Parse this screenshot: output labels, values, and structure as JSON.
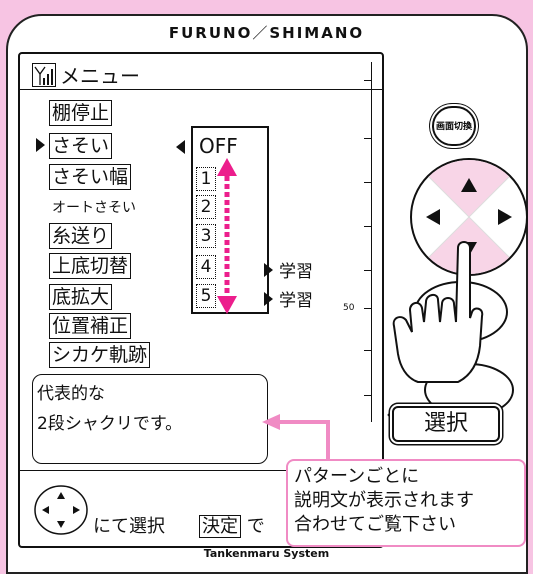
{
  "brand": {
    "left": "FURUNO",
    "separator": "／",
    "right": "SHIMANO"
  },
  "menu": {
    "title": "メニュー",
    "items": [
      {
        "label": "棚停止"
      },
      {
        "label": "さそい"
      },
      {
        "label": "さそい幅"
      },
      {
        "label": "オートさそい"
      },
      {
        "label": "糸送り"
      },
      {
        "label": "上底切替"
      },
      {
        "label": "底拡大"
      },
      {
        "label": "位置補正"
      },
      {
        "label": "シカケ軌跡"
      }
    ]
  },
  "popup": {
    "off_label": "OFF",
    "options": [
      "1",
      "2",
      "3",
      "4",
      "5"
    ],
    "learn_label_4": "学習",
    "learn_label_5": "学習"
  },
  "scale": {
    "label": "50"
  },
  "description": {
    "line1": "代表的な",
    "line2": "2段シャクリです。"
  },
  "instruction": {
    "select_text": "にて選択",
    "ok_label": "決定",
    "ok_suffix": "で"
  },
  "footer": {
    "text": "Tankenmaru System"
  },
  "buttons": {
    "screen_switch": "画面切換",
    "select": "選択"
  },
  "callout": {
    "line1": "パターンごとに",
    "line2": "説明文が表示されます",
    "line3": "合わせてご覧下さい"
  },
  "colors": {
    "accent": "#ec1e8c",
    "background": "#f7c4e3",
    "callout_border": "#f08bc4"
  }
}
